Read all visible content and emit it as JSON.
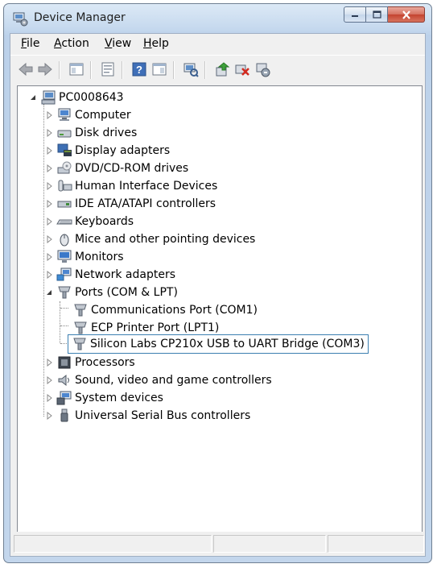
{
  "window": {
    "title": "Device Manager",
    "icons": {
      "app": "device-manager-icon",
      "minimize": "minimize-icon",
      "maximize": "maximize-icon",
      "close": "close-icon"
    }
  },
  "menu": [
    {
      "label": "File",
      "mnemonic": "F",
      "rest": "ile"
    },
    {
      "label": "Action",
      "mnemonic": "A",
      "rest": "ction"
    },
    {
      "label": "View",
      "mnemonic": "V",
      "rest": "iew"
    },
    {
      "label": "Help",
      "mnemonic": "H",
      "rest": "elp"
    }
  ],
  "toolbar": [
    "back-icon",
    "forward-icon",
    "show-hide-console-tree-icon",
    "properties-icon",
    "help-icon",
    "action-pane-icon",
    "scan-hardware-icon",
    "update-driver-icon",
    "disable-device-icon",
    "uninstall-device-icon"
  ],
  "tree": {
    "root": "PC0008643",
    "categories": [
      {
        "label": "Computer",
        "icon": "computer-icon"
      },
      {
        "label": "Disk drives",
        "icon": "disk-drive-icon"
      },
      {
        "label": "Display adapters",
        "icon": "display-adapter-icon"
      },
      {
        "label": "DVD/CD-ROM drives",
        "icon": "dvd-drive-icon"
      },
      {
        "label": "Human Interface Devices",
        "icon": "hid-icon"
      },
      {
        "label": "IDE ATA/ATAPI controllers",
        "icon": "ide-controller-icon"
      },
      {
        "label": "Keyboards",
        "icon": "keyboard-icon"
      },
      {
        "label": "Mice and other pointing devices",
        "icon": "mouse-icon"
      },
      {
        "label": "Monitors",
        "icon": "monitor-icon"
      },
      {
        "label": "Network adapters",
        "icon": "network-adapter-icon"
      },
      {
        "label": "Ports (COM & LPT)",
        "icon": "port-icon",
        "expanded": true,
        "children": [
          {
            "label": "Communications Port (COM1)",
            "icon": "port-icon"
          },
          {
            "label": "ECP Printer Port (LPT1)",
            "icon": "port-icon"
          },
          {
            "label": "Silicon Labs CP210x USB to UART Bridge (COM3)",
            "icon": "port-icon",
            "selected": true
          }
        ]
      },
      {
        "label": "Processors",
        "icon": "processor-icon"
      },
      {
        "label": "Sound, video and game controllers",
        "icon": "sound-icon"
      },
      {
        "label": "System devices",
        "icon": "system-device-icon"
      },
      {
        "label": "Universal Serial Bus controllers",
        "icon": "usb-icon"
      }
    ]
  },
  "colors": {
    "selection_border": "#3c7fb1",
    "close_button": "#c4432f",
    "title_bar": "#c6d9ee"
  }
}
